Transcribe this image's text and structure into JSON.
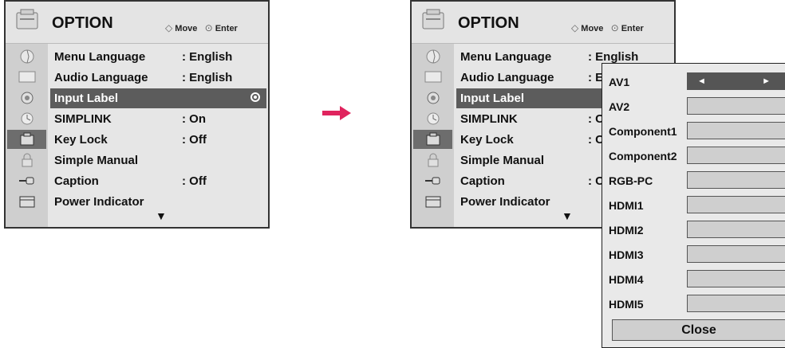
{
  "header": {
    "title": "OPTION",
    "move_label": "Move",
    "enter_label": "Enter"
  },
  "menu": {
    "items": [
      {
        "label": "Menu Language",
        "value": ": English"
      },
      {
        "label": "Audio Language",
        "value": ": English"
      },
      {
        "label": "Input Label",
        "value": ""
      },
      {
        "label": "SIMPLINK",
        "value": ": On"
      },
      {
        "label": "Key Lock",
        "value": ": Off"
      },
      {
        "label": "Simple Manual",
        "value": ""
      },
      {
        "label": "Caption",
        "value": ": Off"
      },
      {
        "label": "Power Indicator",
        "value": ""
      }
    ],
    "selected": "Input Label"
  },
  "right_menu": {
    "truncated_values": [
      ": English",
      ": E",
      "",
      ": C",
      ": C",
      "",
      ": C",
      ""
    ]
  },
  "input_label_popup": {
    "inputs": [
      "AV1",
      "AV2",
      "Component1",
      "Component2",
      "RGB-PC",
      "HDMI1",
      "HDMI2",
      "HDMI3",
      "HDMI4",
      "HDMI5"
    ],
    "selected": "AV1",
    "close_label": "Close"
  },
  "colors": {
    "highlight": "#5c5c5c",
    "arrow": "#e0245e"
  }
}
